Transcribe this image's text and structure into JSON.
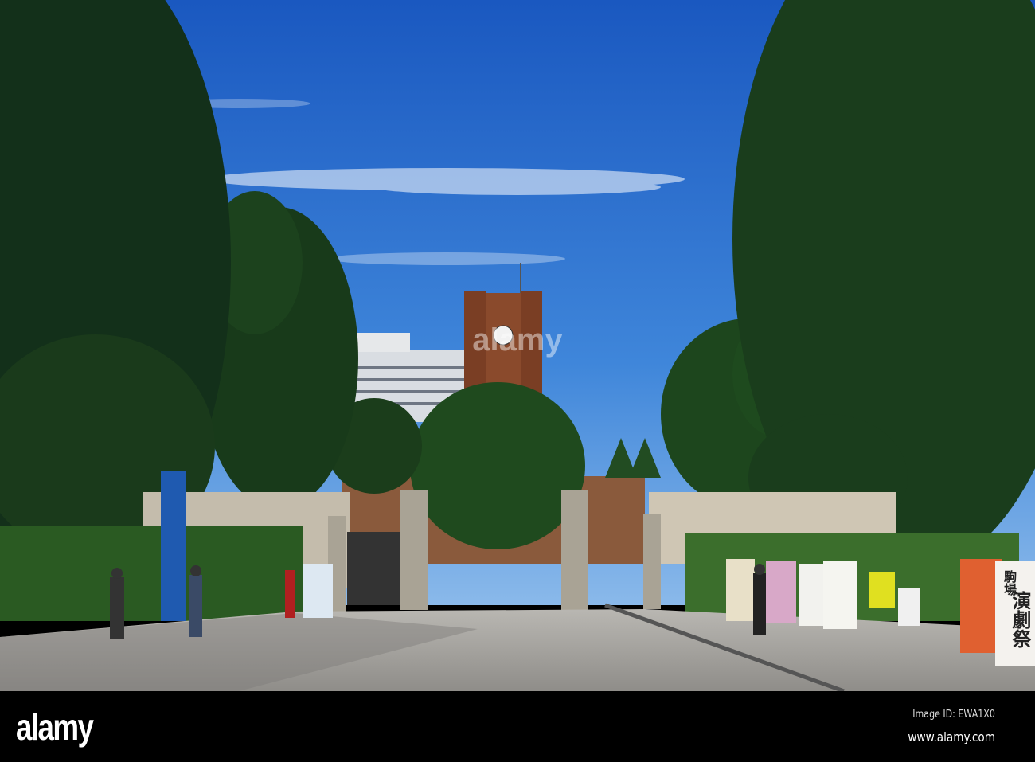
{
  "photo": {
    "subject": "campus gate with clock tower",
    "banner_top": "駒場",
    "banner_main": "演劇祭",
    "watermark": "alamy"
  },
  "footer": {
    "logo": "alamy",
    "image_id": "Image ID: EWA1X0",
    "url": "www.alamy.com"
  },
  "colors": {
    "sky_top": "#1f5fc4",
    "sky_bottom": "#6fa9e6",
    "tree_dark": "#17341a",
    "tower_brick": "#8a4a2c",
    "pavement": "#a8a6a2"
  }
}
